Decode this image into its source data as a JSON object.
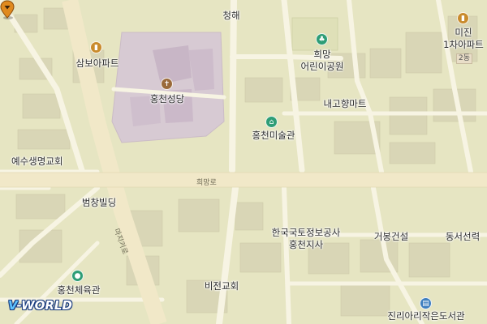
{
  "map": {
    "labels": {
      "cheonghae": "청해",
      "huimang_park_1": "희망",
      "huimang_park_2": "어린이공원",
      "mijin_1": "미진",
      "mijin_2": "1차아파트",
      "mijin_unit": "2동",
      "sambo_apt": "삼보아파트",
      "hongcheon_cathedral": "홍천성당",
      "naegohyang_mart": "내고향마트",
      "hongcheon_art_museum": "홍천미술관",
      "yesu_church": "예수생명교회",
      "beomchang_building": "범창빌딩",
      "lx_1": "한국국토정보공사",
      "lx_2": "홍천지사",
      "geobong": "거봉건설",
      "dongseo_bookstore": "동서선력",
      "hongcheon_gym": "홍천체육관",
      "vision_church": "비전교회",
      "jinri_library": "진리아리작은도서관"
    },
    "road_labels": {
      "huimang_ro": "희망로",
      "yeogi_ro": "마지기로"
    },
    "poi_icons": [
      "apartment-icon",
      "church-icon",
      "museum-icon",
      "park-icon",
      "gym-icon",
      "library-icon",
      "apartment-icon"
    ],
    "marker": "location-pin-icon",
    "colors": {
      "land": "#e6e5c2",
      "road": "#f6f2e2",
      "major_road": "#efe6c4",
      "building": "#d9d6b7",
      "campus": "#d8cbd4",
      "marker": "#e08a1e"
    }
  },
  "branding": {
    "logo_v": "V",
    "logo_rest": "-WORLD"
  }
}
